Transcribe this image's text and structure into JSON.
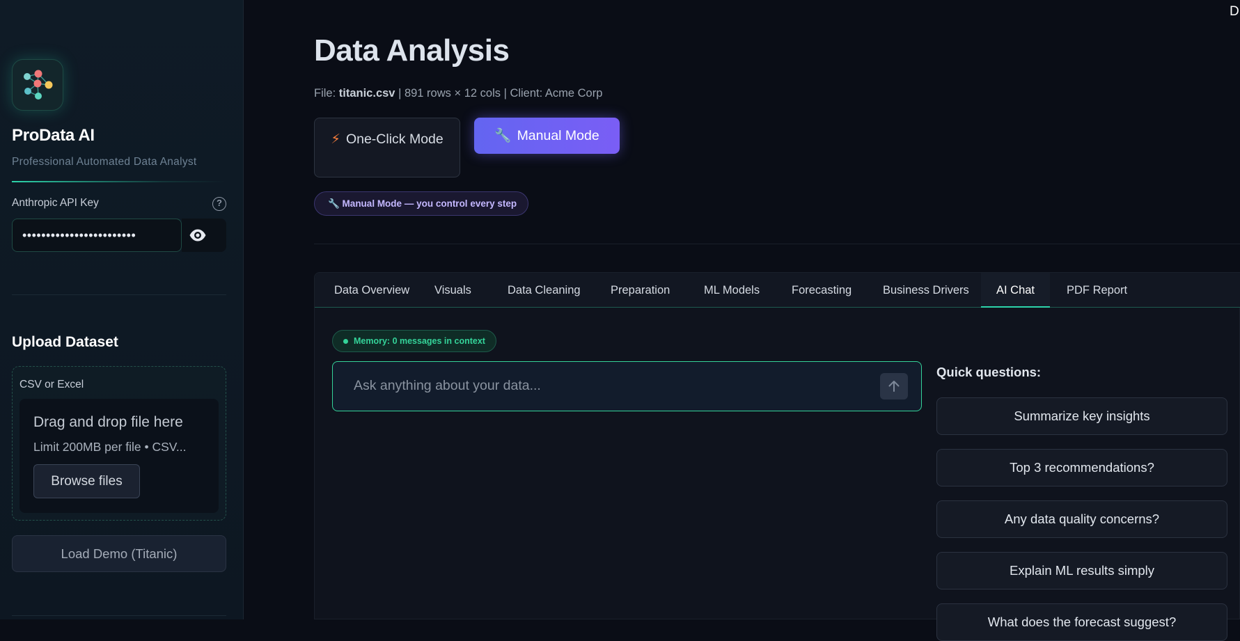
{
  "sidebar": {
    "brand_title": "ProData AI",
    "brand_subtitle": "Professional Automated Data Analyst",
    "api_key_label": "Anthropic API Key",
    "api_key_value": "••••••••••••••••••••••••",
    "upload_title": "Upload Dataset",
    "upload_label": "CSV or Excel",
    "drop_title": "Drag and drop file here",
    "drop_limit": "Limit 200MB per file • CSV...",
    "browse_label": "Browse files",
    "demo_label": "Load Demo (Titanic)",
    "icons": {
      "help": "help-circle-icon",
      "visibility": "eye-icon",
      "logo": "network-nodes-icon"
    }
  },
  "header": {
    "corner_text": "D",
    "title": "Data Analysis",
    "meta_file_label": "File:",
    "meta_file_name": "titanic.csv",
    "meta_rest": "| 891 rows × 12 cols | Client: Acme Corp"
  },
  "modes": {
    "oneclick_icon": "⚡",
    "oneclick_label": "One-Click Mode",
    "manual_icon": "🔧",
    "manual_label": "Manual Mode",
    "badge": "🔧 Manual Mode — you control every step"
  },
  "tabs": [
    {
      "label": "Data Overview"
    },
    {
      "label": "Visuals"
    },
    {
      "label": "Data Cleaning"
    },
    {
      "label": "Preparation"
    },
    {
      "label": "ML Models"
    },
    {
      "label": "Forecasting"
    },
    {
      "label": "Business Drivers"
    },
    {
      "label": "AI Chat",
      "active": true
    },
    {
      "label": "PDF Report"
    }
  ],
  "chat": {
    "memory_badge": "Memory: 0 messages in context",
    "input_placeholder": "Ask anything about your data...",
    "send_icon": "arrow-up-icon",
    "quick_title": "Quick questions:",
    "quick_questions": [
      "Summarize key insights",
      "Top 3 recommendations?",
      "Any data quality concerns?",
      "Explain ML results simply",
      "What does the forecast suggest?"
    ]
  },
  "colors": {
    "accent_teal": "#2dd4aa",
    "accent_green": "#34d399",
    "accent_indigo": "#6365f1",
    "bolt_orange": "#f97e3c",
    "background": "#0a0d16"
  }
}
